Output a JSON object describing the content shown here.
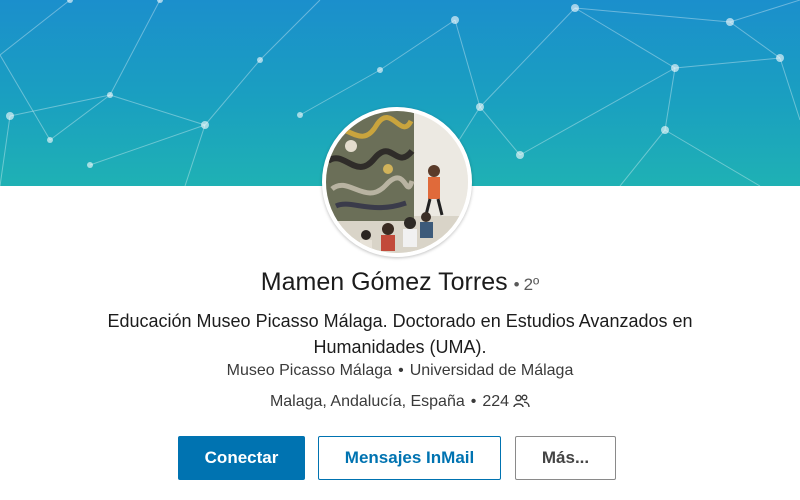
{
  "profile": {
    "name": "Mamen Gómez Torres",
    "degree": "2º",
    "headline": "Educación Museo Picasso Málaga. Doctorado en Estudios Avanzados en Humanidades (UMA).",
    "company": "Museo Picasso Málaga",
    "school": "Universidad de Málaga",
    "location": "Malaga, Andalucía, España",
    "connections": "224",
    "connections_icon": "people-icon"
  },
  "actions": {
    "connect": "Conectar",
    "inmail": "Mensajes InMail",
    "more": "Más..."
  },
  "colors": {
    "primary": "#0073b1",
    "banner_top": "#1b8fcc",
    "banner_bottom": "#1fb1b4"
  }
}
